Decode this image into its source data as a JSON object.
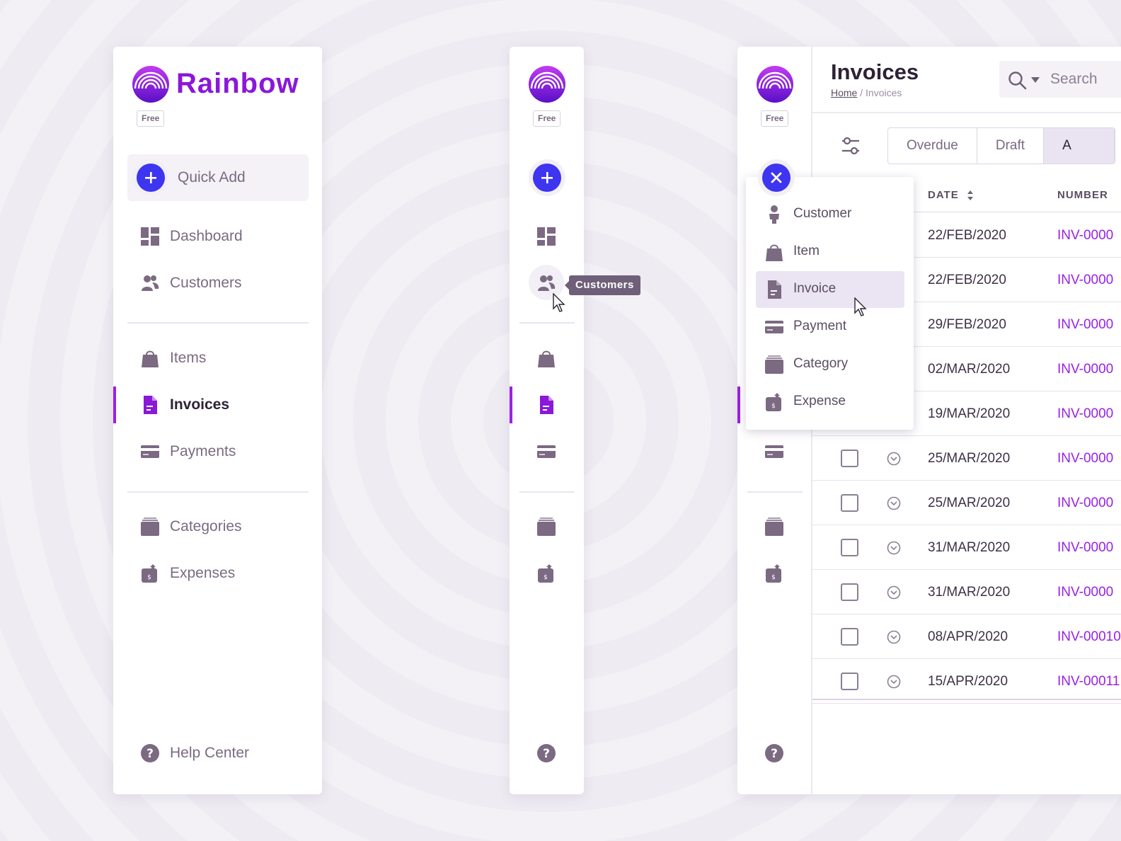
{
  "brand": {
    "name": "Rainbow",
    "plan": "Free",
    "accent": "#9a20e6",
    "action_blue": "#3d35f0"
  },
  "quick_add": {
    "label": "Quick Add"
  },
  "nav": {
    "primary": [
      {
        "label": "Dashboard",
        "icon": "dashboard-icon"
      },
      {
        "label": "Customers",
        "icon": "customers-icon"
      }
    ],
    "sales": [
      {
        "label": "Items",
        "icon": "shopping-bag-icon"
      },
      {
        "label": "Invoices",
        "icon": "invoice-icon",
        "active": true
      },
      {
        "label": "Payments",
        "icon": "credit-card-icon"
      }
    ],
    "purchases": [
      {
        "label": "Categories",
        "icon": "categories-icon"
      },
      {
        "label": "Expenses",
        "icon": "expense-icon"
      }
    ],
    "help": {
      "label": "Help Center",
      "icon": "help-icon"
    }
  },
  "tooltip": {
    "text": "Customers"
  },
  "dropdown": {
    "items": [
      {
        "label": "Customer",
        "icon": "person-icon"
      },
      {
        "label": "Item",
        "icon": "shopping-bag-icon"
      },
      {
        "label": "Invoice",
        "icon": "invoice-icon",
        "highlighted": true
      },
      {
        "label": "Payment",
        "icon": "credit-card-icon"
      },
      {
        "label": "Category",
        "icon": "categories-icon"
      },
      {
        "label": "Expense",
        "icon": "expense-icon"
      }
    ]
  },
  "page": {
    "title": "Invoices",
    "breadcrumb": {
      "home": "Home",
      "separator": "/",
      "current": "Invoices"
    },
    "search": {
      "placeholder": "Search"
    },
    "tabs": [
      {
        "label": "Overdue"
      },
      {
        "label": "Draft"
      },
      {
        "label": "A",
        "selected": true
      }
    ]
  },
  "table": {
    "columns": {
      "date": "DATE",
      "number": "NUMBER"
    },
    "rows": [
      {
        "date": "22/FEB/2020",
        "number": "INV-0000"
      },
      {
        "date": "22/FEB/2020",
        "number": "INV-0000"
      },
      {
        "date": "29/FEB/2020",
        "number": "INV-0000"
      },
      {
        "date": "02/MAR/2020",
        "number": "INV-0000"
      },
      {
        "date": "19/MAR/2020",
        "number": "INV-0000"
      },
      {
        "date": "25/MAR/2020",
        "number": "INV-0000"
      },
      {
        "date": "25/MAR/2020",
        "number": "INV-0000"
      },
      {
        "date": "31/MAR/2020",
        "number": "INV-0000"
      },
      {
        "date": "31/MAR/2020",
        "number": "INV-0000"
      },
      {
        "date": "08/APR/2020",
        "number": "INV-00010"
      },
      {
        "date": "15/APR/2020",
        "number": "INV-00011"
      }
    ]
  }
}
